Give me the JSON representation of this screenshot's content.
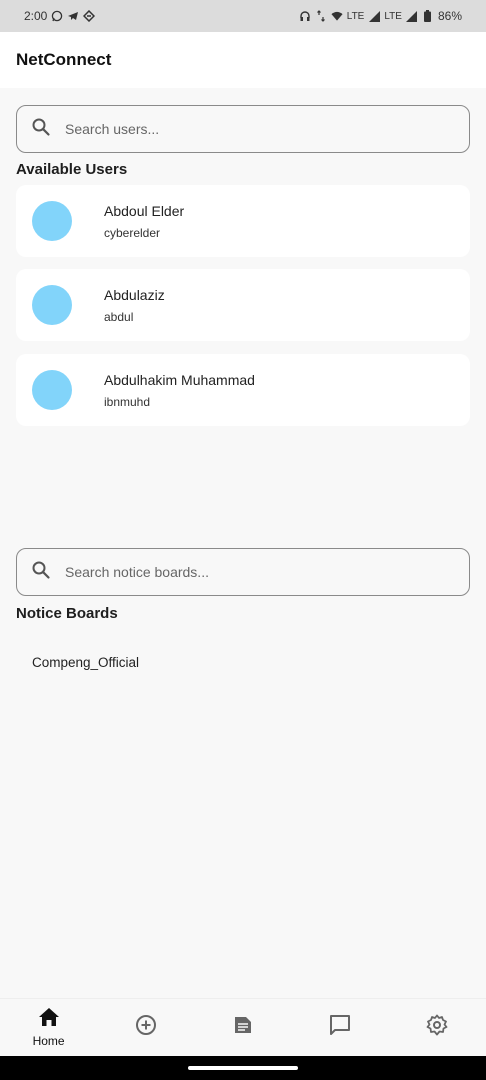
{
  "status_bar": {
    "time": "2:00",
    "network_1": "LTE",
    "network_2": "LTE",
    "battery": "86%",
    "icons": [
      "whatsapp-icon",
      "telegram-icon",
      "app-icon",
      "headphones-icon",
      "data-arrows-icon",
      "wifi-icon",
      "signal-icon",
      "battery-icon"
    ]
  },
  "app_bar": {
    "title": "NetConnect"
  },
  "user_search": {
    "placeholder": "Search users..."
  },
  "users_section": {
    "title": "Available Users",
    "users": [
      {
        "name": "Abdoul Elder",
        "handle": "cyberelder"
      },
      {
        "name": "Abdulaziz",
        "handle": "abdul"
      },
      {
        "name": "Abdulhakim Muhammad",
        "handle": "ibnmuhd"
      }
    ]
  },
  "board_search": {
    "placeholder": "Search notice boards..."
  },
  "boards_section": {
    "title": "Notice Boards",
    "boards": [
      "Compeng_Official"
    ]
  },
  "bottom_nav": {
    "items": [
      {
        "icon": "home-icon",
        "label": "Home"
      },
      {
        "icon": "add-circle-icon",
        "label": ""
      },
      {
        "icon": "article-icon",
        "label": ""
      },
      {
        "icon": "chat-icon",
        "label": ""
      },
      {
        "icon": "settings-icon",
        "label": ""
      }
    ]
  },
  "colors": {
    "avatar": "#82d4fa",
    "background": "#f8f8f8",
    "card": "#ffffff",
    "status_bar": "#dcdcdc"
  }
}
